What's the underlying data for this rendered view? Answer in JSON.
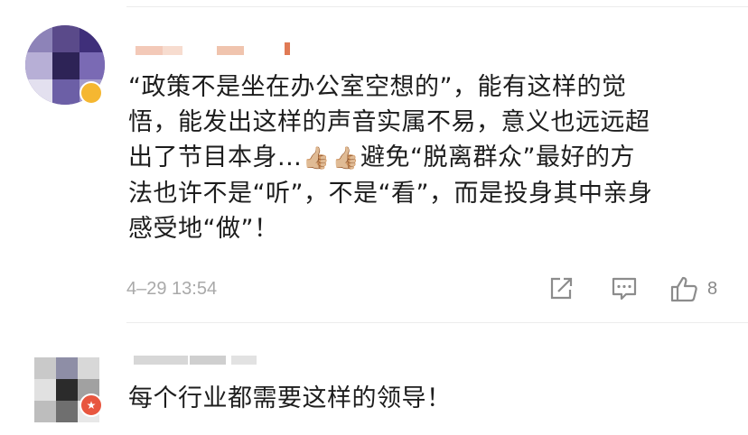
{
  "comments": [
    {
      "text_line1": "“政策不是坐在办公室空想的”，能有这样的觉",
      "text_line2": "悟，能发出这样的声音实属不易，意义也远远超",
      "text_line3_pre": "出了节目本身...",
      "emoji_1": "👍🏼",
      "emoji_2": "👍🏼",
      "text_line3_post": "避免“脱离群众”最好的方",
      "text_line4": "法也许不是“听”，不是“看”，而是投身其中亲身",
      "text_line5": "感受地“做”！",
      "timestamp": "4–29 13:54",
      "like_count": "8",
      "share_icon": "share-icon",
      "reply_icon": "reply-icon",
      "like_icon": "thumbs-up-icon"
    },
    {
      "text": "每个行业都需要这样的领导！"
    }
  ],
  "colors": {
    "text": "#1d1d1d",
    "meta": "#a9a9a9",
    "icon": "#8c8c8c",
    "badge_red": "#e8563f",
    "badge_yellow": "#f5b731"
  }
}
